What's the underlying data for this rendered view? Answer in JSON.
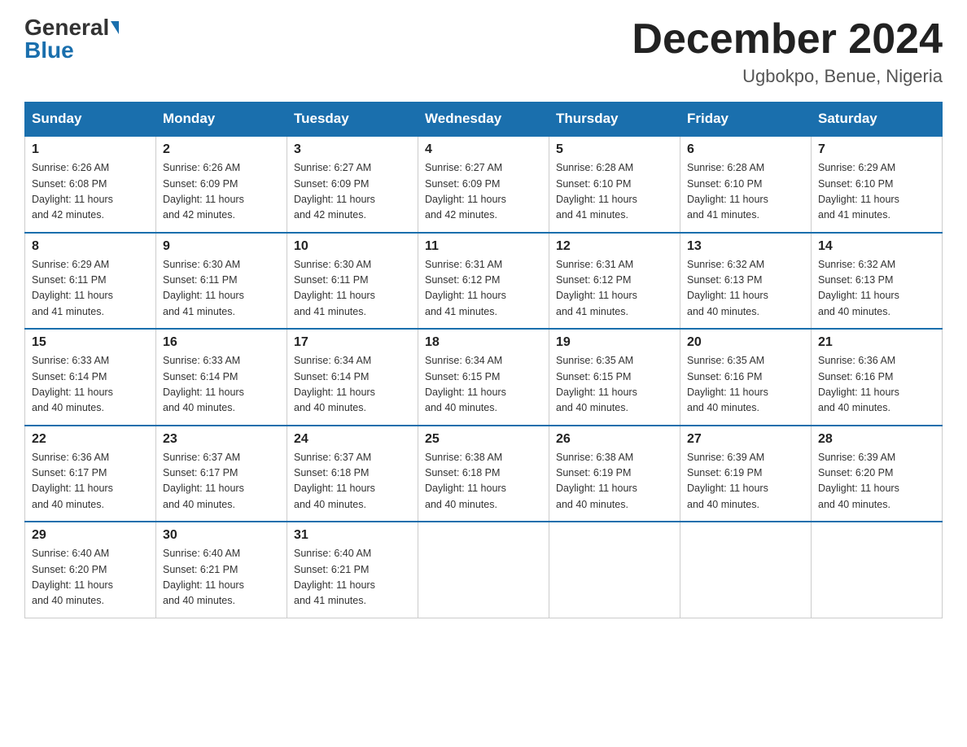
{
  "header": {
    "logo_general": "General",
    "logo_blue": "Blue",
    "title": "December 2024",
    "location": "Ugbokpo, Benue, Nigeria"
  },
  "days_of_week": [
    "Sunday",
    "Monday",
    "Tuesday",
    "Wednesday",
    "Thursday",
    "Friday",
    "Saturday"
  ],
  "weeks": [
    [
      {
        "day": "1",
        "sunrise": "6:26 AM",
        "sunset": "6:08 PM",
        "daylight": "11 hours and 42 minutes."
      },
      {
        "day": "2",
        "sunrise": "6:26 AM",
        "sunset": "6:09 PM",
        "daylight": "11 hours and 42 minutes."
      },
      {
        "day": "3",
        "sunrise": "6:27 AM",
        "sunset": "6:09 PM",
        "daylight": "11 hours and 42 minutes."
      },
      {
        "day": "4",
        "sunrise": "6:27 AM",
        "sunset": "6:09 PM",
        "daylight": "11 hours and 42 minutes."
      },
      {
        "day": "5",
        "sunrise": "6:28 AM",
        "sunset": "6:10 PM",
        "daylight": "11 hours and 41 minutes."
      },
      {
        "day": "6",
        "sunrise": "6:28 AM",
        "sunset": "6:10 PM",
        "daylight": "11 hours and 41 minutes."
      },
      {
        "day": "7",
        "sunrise": "6:29 AM",
        "sunset": "6:10 PM",
        "daylight": "11 hours and 41 minutes."
      }
    ],
    [
      {
        "day": "8",
        "sunrise": "6:29 AM",
        "sunset": "6:11 PM",
        "daylight": "11 hours and 41 minutes."
      },
      {
        "day": "9",
        "sunrise": "6:30 AM",
        "sunset": "6:11 PM",
        "daylight": "11 hours and 41 minutes."
      },
      {
        "day": "10",
        "sunrise": "6:30 AM",
        "sunset": "6:11 PM",
        "daylight": "11 hours and 41 minutes."
      },
      {
        "day": "11",
        "sunrise": "6:31 AM",
        "sunset": "6:12 PM",
        "daylight": "11 hours and 41 minutes."
      },
      {
        "day": "12",
        "sunrise": "6:31 AM",
        "sunset": "6:12 PM",
        "daylight": "11 hours and 41 minutes."
      },
      {
        "day": "13",
        "sunrise": "6:32 AM",
        "sunset": "6:13 PM",
        "daylight": "11 hours and 40 minutes."
      },
      {
        "day": "14",
        "sunrise": "6:32 AM",
        "sunset": "6:13 PM",
        "daylight": "11 hours and 40 minutes."
      }
    ],
    [
      {
        "day": "15",
        "sunrise": "6:33 AM",
        "sunset": "6:14 PM",
        "daylight": "11 hours and 40 minutes."
      },
      {
        "day": "16",
        "sunrise": "6:33 AM",
        "sunset": "6:14 PM",
        "daylight": "11 hours and 40 minutes."
      },
      {
        "day": "17",
        "sunrise": "6:34 AM",
        "sunset": "6:14 PM",
        "daylight": "11 hours and 40 minutes."
      },
      {
        "day": "18",
        "sunrise": "6:34 AM",
        "sunset": "6:15 PM",
        "daylight": "11 hours and 40 minutes."
      },
      {
        "day": "19",
        "sunrise": "6:35 AM",
        "sunset": "6:15 PM",
        "daylight": "11 hours and 40 minutes."
      },
      {
        "day": "20",
        "sunrise": "6:35 AM",
        "sunset": "6:16 PM",
        "daylight": "11 hours and 40 minutes."
      },
      {
        "day": "21",
        "sunrise": "6:36 AM",
        "sunset": "6:16 PM",
        "daylight": "11 hours and 40 minutes."
      }
    ],
    [
      {
        "day": "22",
        "sunrise": "6:36 AM",
        "sunset": "6:17 PM",
        "daylight": "11 hours and 40 minutes."
      },
      {
        "day": "23",
        "sunrise": "6:37 AM",
        "sunset": "6:17 PM",
        "daylight": "11 hours and 40 minutes."
      },
      {
        "day": "24",
        "sunrise": "6:37 AM",
        "sunset": "6:18 PM",
        "daylight": "11 hours and 40 minutes."
      },
      {
        "day": "25",
        "sunrise": "6:38 AM",
        "sunset": "6:18 PM",
        "daylight": "11 hours and 40 minutes."
      },
      {
        "day": "26",
        "sunrise": "6:38 AM",
        "sunset": "6:19 PM",
        "daylight": "11 hours and 40 minutes."
      },
      {
        "day": "27",
        "sunrise": "6:39 AM",
        "sunset": "6:19 PM",
        "daylight": "11 hours and 40 minutes."
      },
      {
        "day": "28",
        "sunrise": "6:39 AM",
        "sunset": "6:20 PM",
        "daylight": "11 hours and 40 minutes."
      }
    ],
    [
      {
        "day": "29",
        "sunrise": "6:40 AM",
        "sunset": "6:20 PM",
        "daylight": "11 hours and 40 minutes."
      },
      {
        "day": "30",
        "sunrise": "6:40 AM",
        "sunset": "6:21 PM",
        "daylight": "11 hours and 40 minutes."
      },
      {
        "day": "31",
        "sunrise": "6:40 AM",
        "sunset": "6:21 PM",
        "daylight": "11 hours and 41 minutes."
      },
      null,
      null,
      null,
      null
    ]
  ],
  "labels": {
    "sunrise": "Sunrise:",
    "sunset": "Sunset:",
    "daylight": "Daylight:"
  }
}
